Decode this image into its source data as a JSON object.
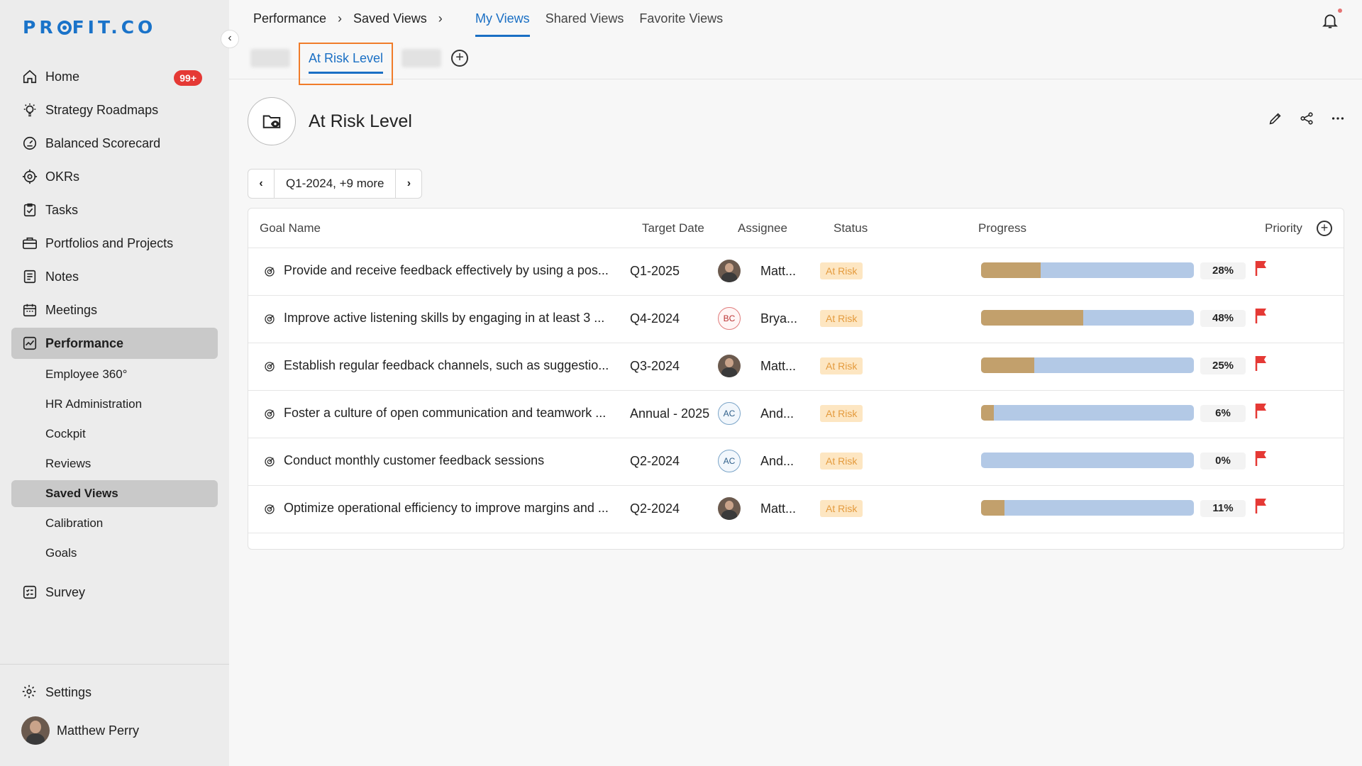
{
  "brand": {
    "logo_text": "PR FIT.CO"
  },
  "sidebar": {
    "items": [
      {
        "label": "Home",
        "icon": "home-icon",
        "badge": "99+"
      },
      {
        "label": "Strategy Roadmaps",
        "icon": "lightbulb-icon"
      },
      {
        "label": "Balanced Scorecard",
        "icon": "scorecard-icon"
      },
      {
        "label": "OKRs",
        "icon": "target-icon"
      },
      {
        "label": "Tasks",
        "icon": "checklist-icon"
      },
      {
        "label": "Portfolios and Projects",
        "icon": "briefcase-icon"
      },
      {
        "label": "Notes",
        "icon": "notes-icon"
      },
      {
        "label": "Meetings",
        "icon": "calendar-icon"
      },
      {
        "label": "Performance",
        "icon": "chart-line-icon",
        "active": true
      }
    ],
    "sub_items": [
      {
        "label": "Employee 360°"
      },
      {
        "label": "HR Administration"
      },
      {
        "label": "Cockpit"
      },
      {
        "label": "Reviews"
      },
      {
        "label": "Saved Views",
        "active": true
      },
      {
        "label": "Calibration"
      },
      {
        "label": "Goals"
      }
    ],
    "survey": "Survey",
    "settings": "Settings",
    "user": "Matthew Perry"
  },
  "breadcrumb": {
    "first": "Performance",
    "second": "Saved Views"
  },
  "view_tabs": [
    {
      "label": "My Views",
      "active": true
    },
    {
      "label": "Shared Views"
    },
    {
      "label": "Favorite Views"
    }
  ],
  "subtab": {
    "active_label": "At Risk Level"
  },
  "view": {
    "title": "At Risk Level"
  },
  "period": {
    "label": "Q1-2024, +9 more"
  },
  "table": {
    "headers": {
      "goal": "Goal Name",
      "target": "Target Date",
      "assignee": "Assignee",
      "status": "Status",
      "progress": "Progress",
      "priority": "Priority"
    },
    "rows": [
      {
        "goal": "Provide and receive feedback effectively by using a pos...",
        "target": "Q1-2025",
        "avatar": "photo",
        "initials": "",
        "assignee": "Matt...",
        "status": "At Risk",
        "progress": 28,
        "progress_label": "28%"
      },
      {
        "goal": "Improve active listening skills by engaging in at least 3 ...",
        "target": "Q4-2024",
        "avatar": "bc",
        "initials": "BC",
        "assignee": "Brya...",
        "status": "At Risk",
        "progress": 48,
        "progress_label": "48%"
      },
      {
        "goal": "Establish regular feedback channels, such as suggestio...",
        "target": "Q3-2024",
        "avatar": "photo",
        "initials": "",
        "assignee": "Matt...",
        "status": "At Risk",
        "progress": 25,
        "progress_label": "25%"
      },
      {
        "goal": "Foster a culture of open communication and teamwork ...",
        "target": "Annual - 2025",
        "avatar": "ac",
        "initials": "AC",
        "assignee": "And...",
        "status": "At Risk",
        "progress": 6,
        "progress_label": "6%"
      },
      {
        "goal": "Conduct monthly customer feedback sessions",
        "target": "Q2-2024",
        "avatar": "ac",
        "initials": "AC",
        "assignee": "And...",
        "status": "At Risk",
        "progress": 0,
        "progress_label": "0%"
      },
      {
        "goal": "Optimize operational efficiency to improve margins and ...",
        "target": "Q2-2024",
        "avatar": "photo",
        "initials": "",
        "assignee": "Matt...",
        "status": "At Risk",
        "progress": 11,
        "progress_label": "11%"
      }
    ]
  },
  "colors": {
    "accent": "#1a6fc4",
    "progress_fill": "#c2a06c",
    "progress_track": "#b3c9e6",
    "status_bg": "#fde6c2",
    "status_text": "#e49b3e",
    "flag": "#e53935",
    "highlight_box": "#f07c2a"
  }
}
